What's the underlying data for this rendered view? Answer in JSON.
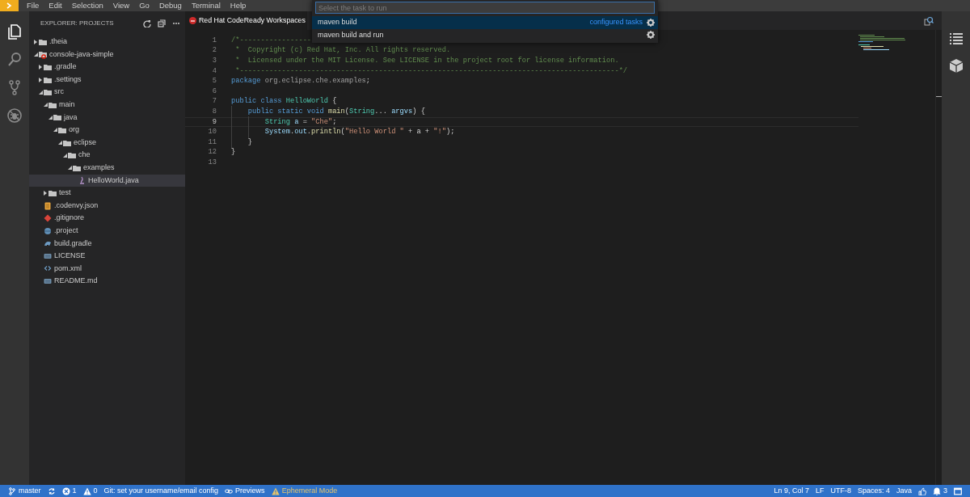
{
  "menubar": {
    "items": [
      "File",
      "Edit",
      "Selection",
      "View",
      "Go",
      "Debug",
      "Terminal",
      "Help"
    ]
  },
  "activity_bar": {
    "items": [
      {
        "kind": "files",
        "selected": true
      },
      {
        "kind": "search",
        "selected": false
      },
      {
        "kind": "source-control",
        "selected": false
      },
      {
        "kind": "debug",
        "selected": false
      }
    ]
  },
  "explorer": {
    "title": "EXPLORER: PROJECTS",
    "tree": [
      {
        "label": ".theia",
        "kind": "folder",
        "expanded": false,
        "selected": false,
        "problem": false
      },
      {
        "label": "console-java-simple",
        "kind": "folder",
        "expanded": true,
        "selected": false,
        "problem": true,
        "children": [
          {
            "label": ".gradle",
            "kind": "folder",
            "expanded": false,
            "selected": false,
            "problem": false
          },
          {
            "label": ".settings",
            "kind": "folder",
            "expanded": false,
            "selected": false,
            "problem": false
          },
          {
            "label": "src",
            "kind": "folder",
            "expanded": true,
            "selected": false,
            "problem": false,
            "children": [
              {
                "label": "main",
                "kind": "folder",
                "expanded": true,
                "selected": false,
                "problem": false,
                "children": [
                  {
                    "label": "java",
                    "kind": "folder",
                    "expanded": true,
                    "selected": false,
                    "problem": false,
                    "children": [
                      {
                        "label": "org",
                        "kind": "folder",
                        "expanded": true,
                        "selected": false,
                        "problem": false,
                        "children": [
                          {
                            "label": "eclipse",
                            "kind": "folder",
                            "expanded": true,
                            "selected": false,
                            "problem": false,
                            "children": [
                              {
                                "label": "che",
                                "kind": "folder",
                                "expanded": true,
                                "selected": false,
                                "problem": false,
                                "children": [
                                  {
                                    "label": "examples",
                                    "kind": "folder",
                                    "expanded": true,
                                    "selected": false,
                                    "problem": false,
                                    "children": [
                                      {
                                        "label": "HelloWorld.java",
                                        "kind": "java",
                                        "selected": true,
                                        "problem": false
                                      }
                                    ]
                                  }
                                ]
                              }
                            ]
                          }
                        ]
                      }
                    ]
                  }
                ]
              },
              {
                "label": "test",
                "kind": "folder",
                "expanded": false,
                "selected": false,
                "problem": false
              }
            ]
          },
          {
            "label": ".codenvy.json",
            "kind": "json",
            "selected": false,
            "problem": false
          },
          {
            "label": ".gitignore",
            "kind": "git",
            "selected": false,
            "problem": false
          },
          {
            "label": ".project",
            "kind": "project",
            "selected": false,
            "problem": false
          },
          {
            "label": "build.gradle",
            "kind": "gradle",
            "selected": false,
            "problem": false
          },
          {
            "label": "LICENSE",
            "kind": "text",
            "selected": false,
            "problem": false
          },
          {
            "label": "pom.xml",
            "kind": "xml",
            "selected": false,
            "problem": false
          },
          {
            "label": "README.md",
            "kind": "text",
            "selected": false,
            "problem": false
          }
        ]
      }
    ]
  },
  "editor": {
    "tab": {
      "label": "Red Hat CodeReady Workspaces",
      "selected": true
    },
    "lines": [
      {
        "number": "1",
        "current": false,
        "tokens": [
          {
            "kind": "comment",
            "text": "/*-----------------"
          }
        ]
      },
      {
        "number": "2",
        "current": false,
        "tokens": [
          {
            "kind": "comment",
            "text": " *  Copyright (c) Red Hat, Inc. All rights reserved."
          }
        ]
      },
      {
        "number": "3",
        "current": false,
        "tokens": [
          {
            "kind": "comment",
            "text": " *  Licensed under the MIT License. See LICENSE in the project root for license information."
          }
        ]
      },
      {
        "number": "4",
        "current": false,
        "tokens": [
          {
            "kind": "comment",
            "text": " *------------------------------------------------------------------------------------------*/"
          }
        ]
      },
      {
        "number": "5",
        "current": false,
        "tokens": [
          {
            "kind": "keyword",
            "text": "package"
          },
          {
            "kind": "name",
            "text": " org.eclipse.che.examples"
          },
          {
            "kind": "plain",
            "text": ";"
          }
        ]
      },
      {
        "number": "6",
        "current": false
      },
      {
        "number": "7",
        "current": false,
        "tokens": [
          {
            "kind": "keyword",
            "text": "public class"
          },
          {
            "kind": "type",
            "text": " HelloWorld"
          },
          {
            "kind": "plain",
            "text": " {"
          }
        ]
      },
      {
        "number": "8",
        "current": false,
        "tokens": [
          {
            "kind": "keyword",
            "text": "    public static void"
          },
          {
            "kind": "function",
            "text": " main"
          },
          {
            "kind": "plain",
            "text": "("
          },
          {
            "kind": "type",
            "text": "String"
          },
          {
            "kind": "plain",
            "text": "..."
          },
          {
            "kind": "variable",
            "text": " argvs"
          },
          {
            "kind": "plain",
            "text": ") {"
          }
        ]
      },
      {
        "number": "9",
        "current": true,
        "tokens": [
          {
            "kind": "type",
            "text": "        String"
          },
          {
            "kind": "variable",
            "text": " a"
          },
          {
            "kind": "plain",
            "text": " = "
          },
          {
            "kind": "string",
            "text": "\"Che\""
          },
          {
            "kind": "plain",
            "text": ";"
          }
        ]
      },
      {
        "number": "10",
        "current": false,
        "tokens": [
          {
            "kind": "variable",
            "text": "        System"
          },
          {
            "kind": "plain",
            "text": "."
          },
          {
            "kind": "variable",
            "text": "out"
          },
          {
            "kind": "plain",
            "text": "."
          },
          {
            "kind": "function",
            "text": "println"
          },
          {
            "kind": "plain",
            "text": "("
          },
          {
            "kind": "string",
            "text": "\"Hello World \""
          },
          {
            "kind": "plain",
            "text": " + a + "
          },
          {
            "kind": "string",
            "text": "\"!\""
          },
          {
            "kind": "plain",
            "text": ");"
          }
        ]
      },
      {
        "number": "11",
        "current": false,
        "tokens": [
          {
            "kind": "plain",
            "text": "    }"
          }
        ]
      },
      {
        "number": "12",
        "current": false,
        "tokens": [
          {
            "kind": "plain",
            "text": "}"
          }
        ]
      },
      {
        "number": "13",
        "current": false
      }
    ]
  },
  "quick_pick": {
    "placeholder": "Select the task to run",
    "items": [
      {
        "label": "maven build",
        "detail": "configured tasks",
        "selected": true
      },
      {
        "label": "maven build and run",
        "selected": false
      }
    ]
  },
  "right_bar": {
    "items": [
      {
        "kind": "outline"
      },
      {
        "kind": "cube"
      }
    ]
  },
  "status_bar": {
    "left": [
      {
        "kind": "branch",
        "text": "master"
      },
      {
        "kind": "sync"
      },
      {
        "kind": "error",
        "text": "1"
      },
      {
        "kind": "warning",
        "text": "0"
      },
      {
        "kind": "text",
        "text": "Git: set your username/email config"
      },
      {
        "kind": "link",
        "text": "Previews"
      },
      {
        "kind": "notice",
        "text": "Ephemeral Mode"
      }
    ],
    "right": [
      {
        "kind": "text",
        "text": "Ln 9, Col 7"
      },
      {
        "kind": "text",
        "text": "LF"
      },
      {
        "kind": "text",
        "text": "UTF-8"
      },
      {
        "kind": "text",
        "text": "Spaces: 4"
      },
      {
        "kind": "text",
        "text": "Java"
      },
      {
        "kind": "thumb"
      },
      {
        "kind": "bell",
        "text": "3"
      },
      {
        "kind": "window"
      }
    ]
  }
}
